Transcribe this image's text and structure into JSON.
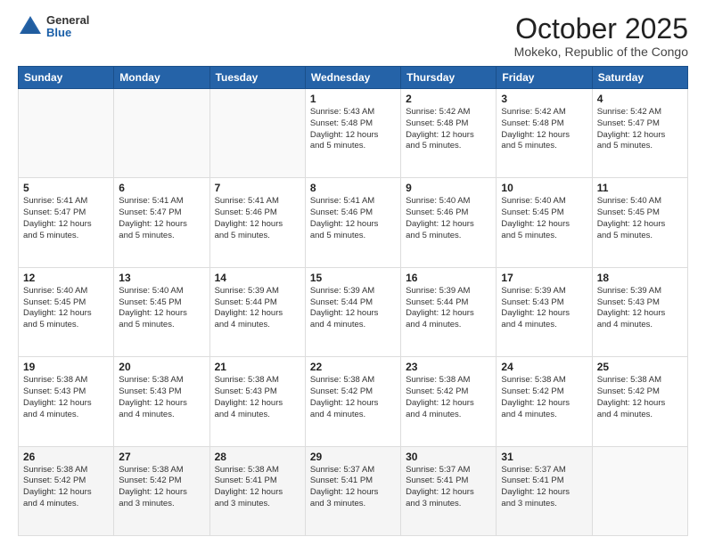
{
  "logo": {
    "general": "General",
    "blue": "Blue"
  },
  "title": "October 2025",
  "location": "Mokeko, Republic of the Congo",
  "days_header": [
    "Sunday",
    "Monday",
    "Tuesday",
    "Wednesday",
    "Thursday",
    "Friday",
    "Saturday"
  ],
  "weeks": [
    [
      {
        "day": "",
        "content": ""
      },
      {
        "day": "",
        "content": ""
      },
      {
        "day": "",
        "content": ""
      },
      {
        "day": "1",
        "content": "Sunrise: 5:43 AM\nSunset: 5:48 PM\nDaylight: 12 hours\nand 5 minutes."
      },
      {
        "day": "2",
        "content": "Sunrise: 5:42 AM\nSunset: 5:48 PM\nDaylight: 12 hours\nand 5 minutes."
      },
      {
        "day": "3",
        "content": "Sunrise: 5:42 AM\nSunset: 5:48 PM\nDaylight: 12 hours\nand 5 minutes."
      },
      {
        "day": "4",
        "content": "Sunrise: 5:42 AM\nSunset: 5:47 PM\nDaylight: 12 hours\nand 5 minutes."
      }
    ],
    [
      {
        "day": "5",
        "content": "Sunrise: 5:41 AM\nSunset: 5:47 PM\nDaylight: 12 hours\nand 5 minutes."
      },
      {
        "day": "6",
        "content": "Sunrise: 5:41 AM\nSunset: 5:47 PM\nDaylight: 12 hours\nand 5 minutes."
      },
      {
        "day": "7",
        "content": "Sunrise: 5:41 AM\nSunset: 5:46 PM\nDaylight: 12 hours\nand 5 minutes."
      },
      {
        "day": "8",
        "content": "Sunrise: 5:41 AM\nSunset: 5:46 PM\nDaylight: 12 hours\nand 5 minutes."
      },
      {
        "day": "9",
        "content": "Sunrise: 5:40 AM\nSunset: 5:46 PM\nDaylight: 12 hours\nand 5 minutes."
      },
      {
        "day": "10",
        "content": "Sunrise: 5:40 AM\nSunset: 5:45 PM\nDaylight: 12 hours\nand 5 minutes."
      },
      {
        "day": "11",
        "content": "Sunrise: 5:40 AM\nSunset: 5:45 PM\nDaylight: 12 hours\nand 5 minutes."
      }
    ],
    [
      {
        "day": "12",
        "content": "Sunrise: 5:40 AM\nSunset: 5:45 PM\nDaylight: 12 hours\nand 5 minutes."
      },
      {
        "day": "13",
        "content": "Sunrise: 5:40 AM\nSunset: 5:45 PM\nDaylight: 12 hours\nand 5 minutes."
      },
      {
        "day": "14",
        "content": "Sunrise: 5:39 AM\nSunset: 5:44 PM\nDaylight: 12 hours\nand 4 minutes."
      },
      {
        "day": "15",
        "content": "Sunrise: 5:39 AM\nSunset: 5:44 PM\nDaylight: 12 hours\nand 4 minutes."
      },
      {
        "day": "16",
        "content": "Sunrise: 5:39 AM\nSunset: 5:44 PM\nDaylight: 12 hours\nand 4 minutes."
      },
      {
        "day": "17",
        "content": "Sunrise: 5:39 AM\nSunset: 5:43 PM\nDaylight: 12 hours\nand 4 minutes."
      },
      {
        "day": "18",
        "content": "Sunrise: 5:39 AM\nSunset: 5:43 PM\nDaylight: 12 hours\nand 4 minutes."
      }
    ],
    [
      {
        "day": "19",
        "content": "Sunrise: 5:38 AM\nSunset: 5:43 PM\nDaylight: 12 hours\nand 4 minutes."
      },
      {
        "day": "20",
        "content": "Sunrise: 5:38 AM\nSunset: 5:43 PM\nDaylight: 12 hours\nand 4 minutes."
      },
      {
        "day": "21",
        "content": "Sunrise: 5:38 AM\nSunset: 5:43 PM\nDaylight: 12 hours\nand 4 minutes."
      },
      {
        "day": "22",
        "content": "Sunrise: 5:38 AM\nSunset: 5:42 PM\nDaylight: 12 hours\nand 4 minutes."
      },
      {
        "day": "23",
        "content": "Sunrise: 5:38 AM\nSunset: 5:42 PM\nDaylight: 12 hours\nand 4 minutes."
      },
      {
        "day": "24",
        "content": "Sunrise: 5:38 AM\nSunset: 5:42 PM\nDaylight: 12 hours\nand 4 minutes."
      },
      {
        "day": "25",
        "content": "Sunrise: 5:38 AM\nSunset: 5:42 PM\nDaylight: 12 hours\nand 4 minutes."
      }
    ],
    [
      {
        "day": "26",
        "content": "Sunrise: 5:38 AM\nSunset: 5:42 PM\nDaylight: 12 hours\nand 4 minutes."
      },
      {
        "day": "27",
        "content": "Sunrise: 5:38 AM\nSunset: 5:42 PM\nDaylight: 12 hours\nand 3 minutes."
      },
      {
        "day": "28",
        "content": "Sunrise: 5:38 AM\nSunset: 5:41 PM\nDaylight: 12 hours\nand 3 minutes."
      },
      {
        "day": "29",
        "content": "Sunrise: 5:37 AM\nSunset: 5:41 PM\nDaylight: 12 hours\nand 3 minutes."
      },
      {
        "day": "30",
        "content": "Sunrise: 5:37 AM\nSunset: 5:41 PM\nDaylight: 12 hours\nand 3 minutes."
      },
      {
        "day": "31",
        "content": "Sunrise: 5:37 AM\nSunset: 5:41 PM\nDaylight: 12 hours\nand 3 minutes."
      },
      {
        "day": "",
        "content": ""
      }
    ]
  ]
}
